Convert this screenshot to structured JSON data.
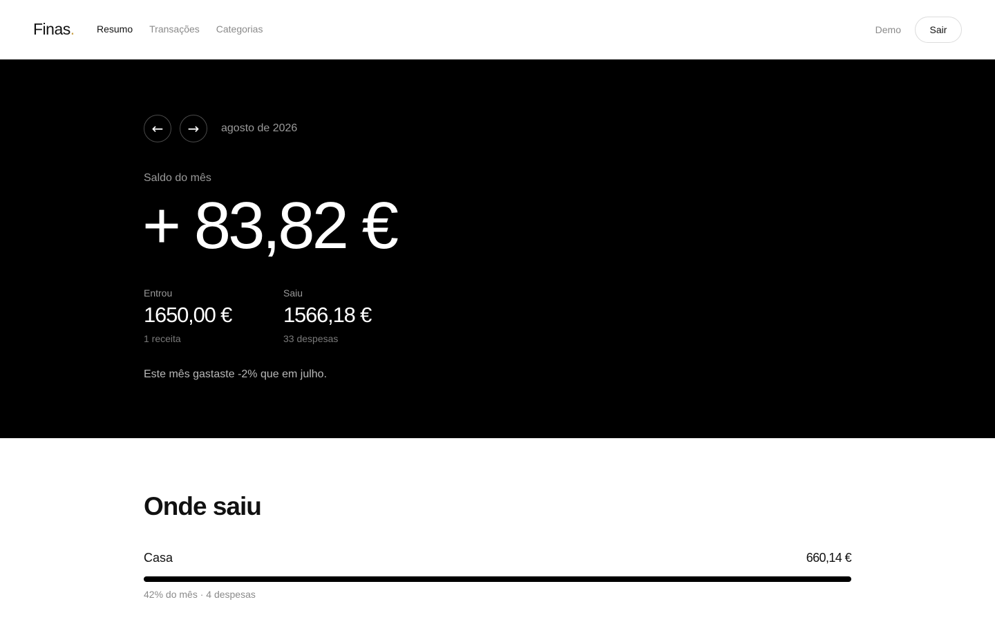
{
  "header": {
    "logo": "Finas",
    "logo_dot": ".",
    "nav": [
      {
        "label": "Resumo",
        "active": true
      },
      {
        "label": "Transações",
        "active": false
      },
      {
        "label": "Categorias",
        "active": false
      }
    ],
    "user": "Demo",
    "logout_label": "Sair"
  },
  "hero": {
    "prev_label": "←",
    "next_label": "→",
    "month": "agosto de 2026",
    "balance_label": "Saldo do mês",
    "balance_value": "+ 83,82 €",
    "income": {
      "label": "Entrou",
      "value": "1650,00 €",
      "sub": "1 receita"
    },
    "expenses": {
      "label": "Saiu",
      "value": "1566,18 €",
      "sub": "33 despesas"
    },
    "comparison": "Este mês gastaste -2% que em julho."
  },
  "breakdown": {
    "title": "Onde saiu",
    "categories": [
      {
        "name": "Casa",
        "amount": "660,14 €",
        "bar_fraction": 1.0,
        "meta": "42% do mês · 4 despesas"
      }
    ]
  }
}
